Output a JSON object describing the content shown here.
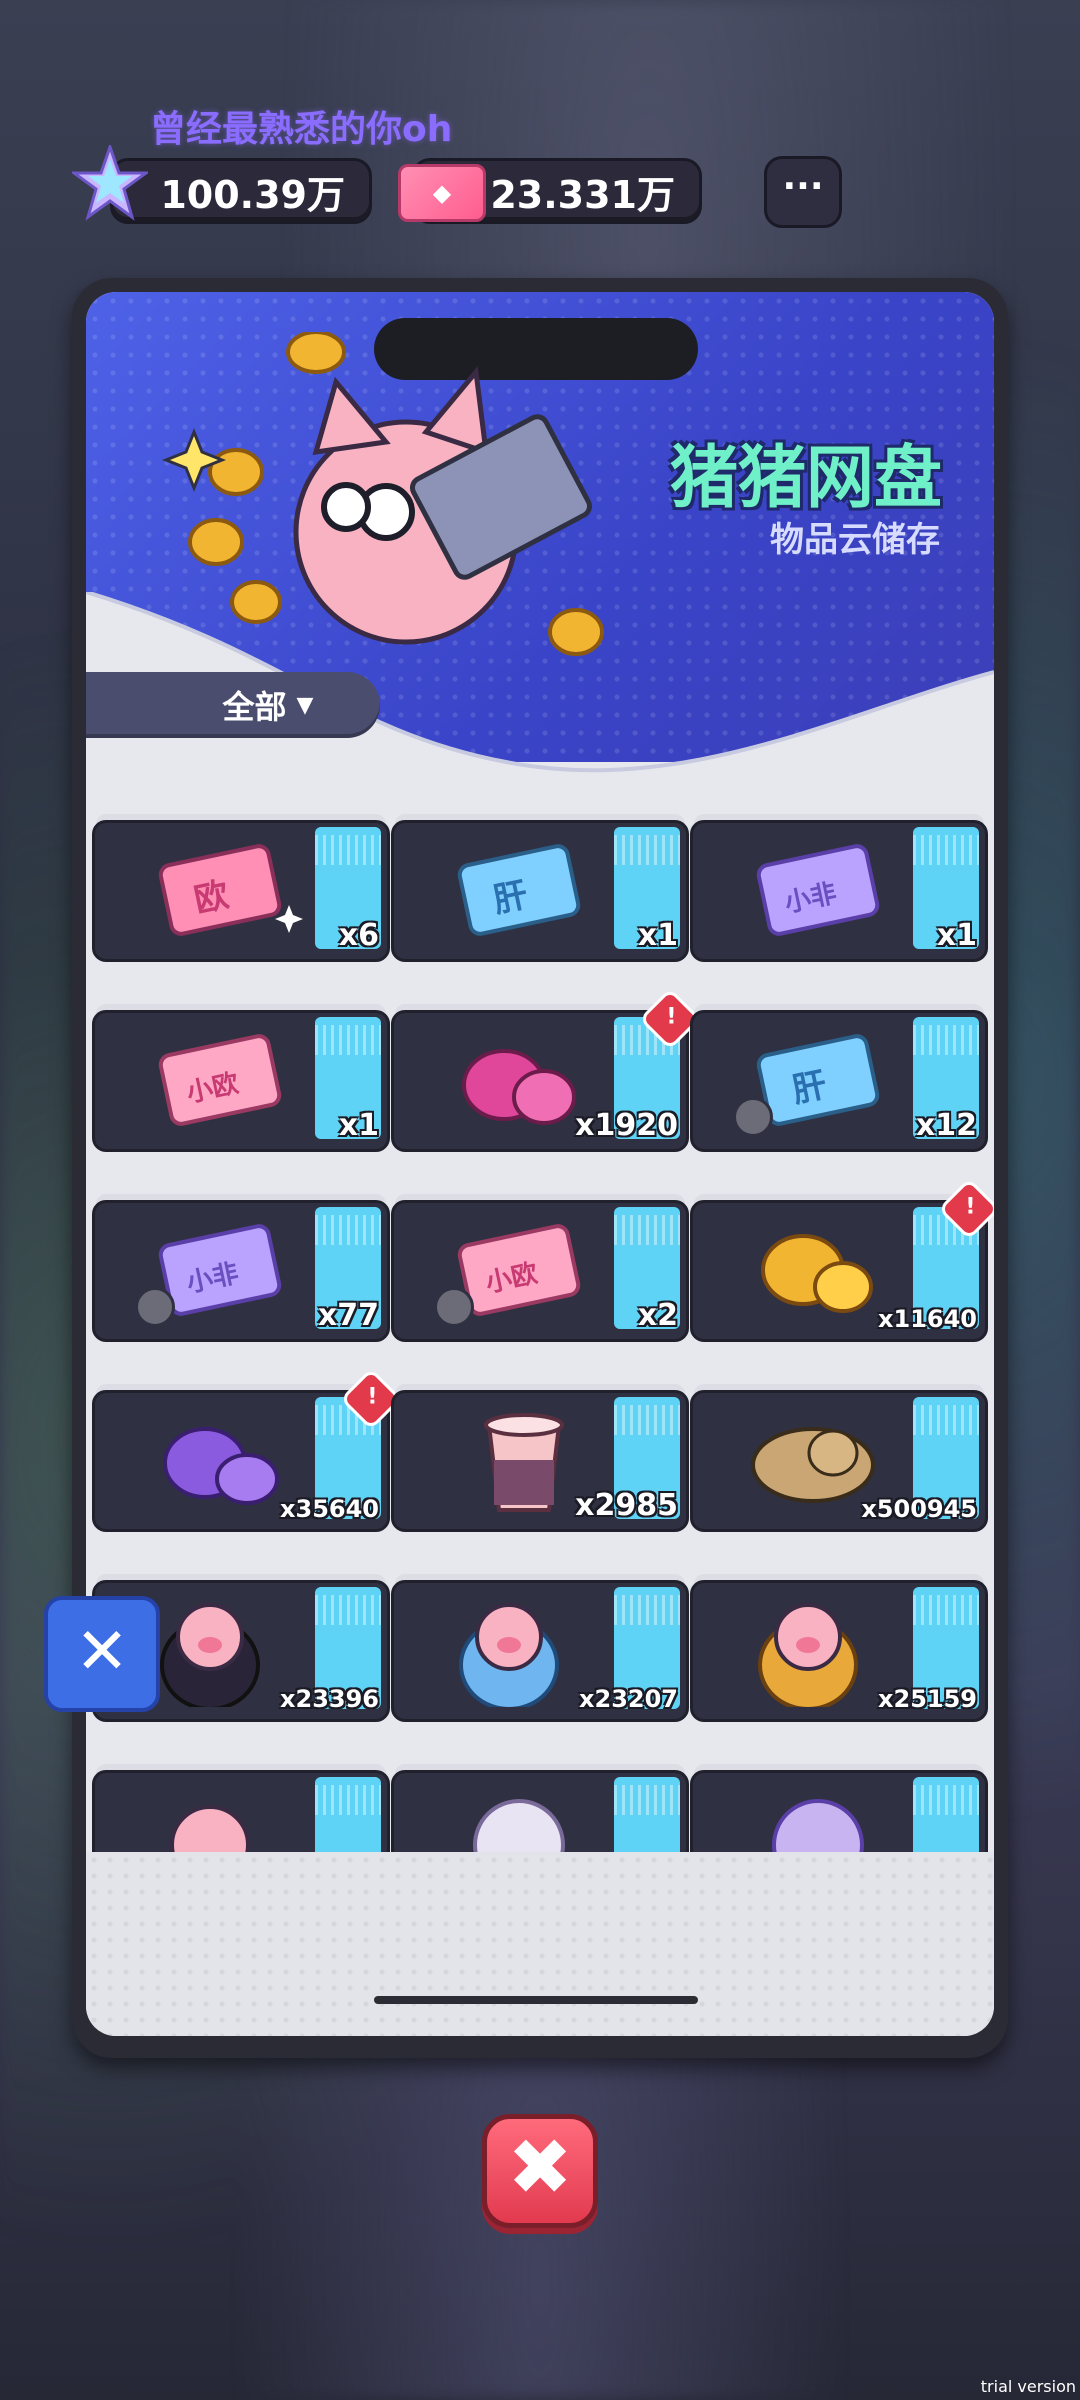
{
  "header": {
    "username": "曾经最熟悉的你oh",
    "star_currency": "100.39万",
    "ticket_currency": "23.331万",
    "more_label": "···"
  },
  "banner": {
    "title": "猪猪网盘",
    "subtitle": "物品云储存"
  },
  "filter": {
    "label": "全部",
    "arrow": "▼"
  },
  "items": [
    {
      "name": "ou-ticket",
      "count": "x6"
    },
    {
      "name": "gan-ticket",
      "count": "x1"
    },
    {
      "name": "xiaofei-ticket",
      "count": "x1"
    },
    {
      "name": "xiaoou-ticket",
      "count": "x1"
    },
    {
      "name": "pink-gem",
      "count": "x1920"
    },
    {
      "name": "gan-ticket-bound",
      "count": "x12"
    },
    {
      "name": "xiaofei-ticket-bound",
      "count": "x77"
    },
    {
      "name": "xiaoou-ticket-bound",
      "count": "x2"
    },
    {
      "name": "gold-gem",
      "count": "x11640"
    },
    {
      "name": "purple-gem",
      "count": "x35640"
    },
    {
      "name": "milk-tea",
      "count": "x2985"
    },
    {
      "name": "croissant",
      "count": "x500945"
    },
    {
      "name": "purple-pig",
      "count": "x23396"
    },
    {
      "name": "blue-pig",
      "count": "x23207"
    },
    {
      "name": "yellow-pig",
      "count": "x25159"
    }
  ],
  "alert_mark": "!",
  "close_icon": "✕",
  "big_close_icon": "✖",
  "watermark": "trial version",
  "colors": {
    "banner": "#4e62e8",
    "stripe": "#5fd3f5",
    "title": "#6ff0c8",
    "close_button": "#3d6ee6",
    "big_close": "#ff6b7c"
  }
}
